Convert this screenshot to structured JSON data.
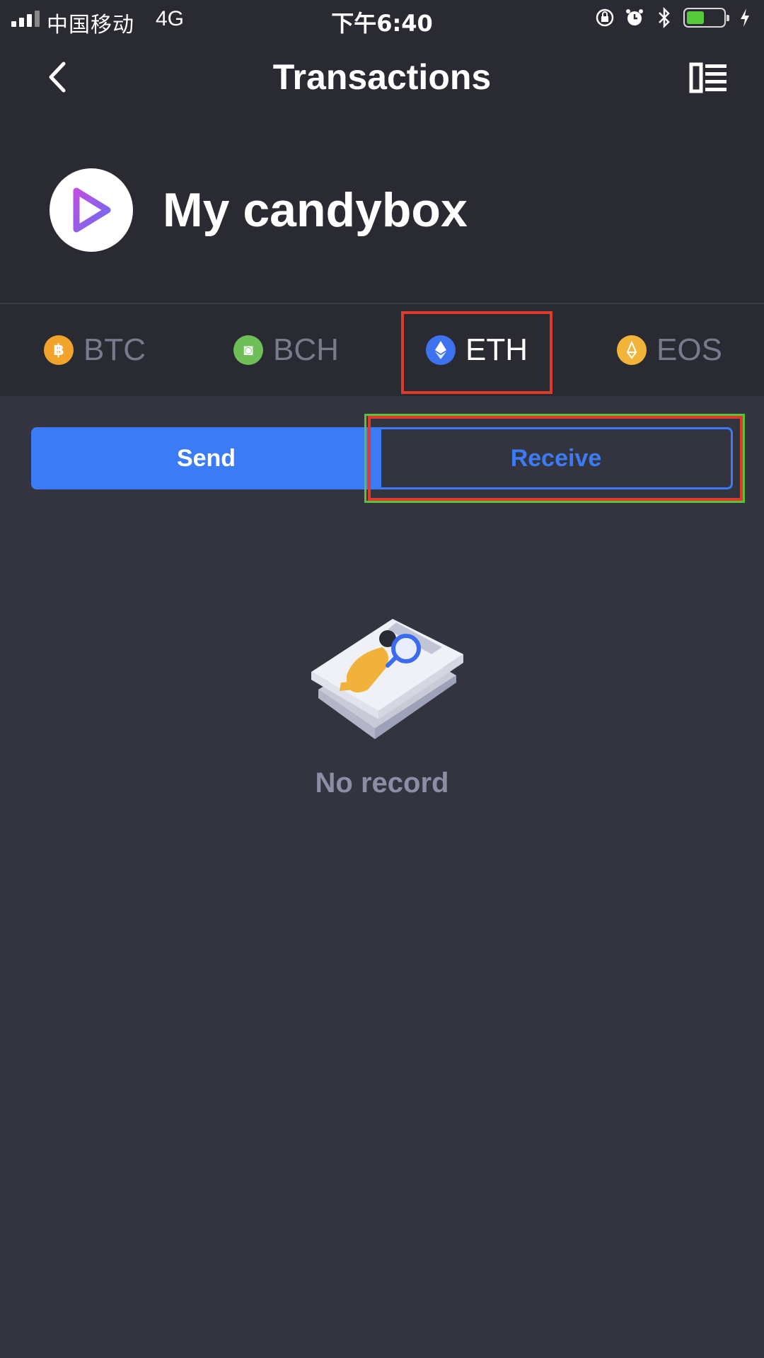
{
  "status_bar": {
    "carrier": "中国移动",
    "network": "4G",
    "time": "下午6:40",
    "battery_color": "#58c93a"
  },
  "nav": {
    "title": "Transactions",
    "back_icon": "chevron-left-icon",
    "menu_icon": "list-view-icon"
  },
  "wallet": {
    "name": "My candybox",
    "avatar_icon": "play-triangle-icon"
  },
  "tabs": [
    {
      "label": "BTC",
      "icon": "bitcoin-coin-icon",
      "color": "#f2a32b",
      "active": false
    },
    {
      "label": "BCH",
      "icon": "bitcoin-cash-coin-icon",
      "color": "#6fbf58",
      "active": false
    },
    {
      "label": "ETH",
      "icon": "ethereum-coin-icon",
      "color": "#3d72f0",
      "active": true
    },
    {
      "label": "EOS",
      "icon": "eos-coin-icon",
      "color": "#f2b53a",
      "active": false
    }
  ],
  "actions": {
    "send_label": "Send",
    "receive_label": "Receive",
    "accent": "#3b7cf6"
  },
  "empty_state": {
    "icon": "search-document-illustration",
    "text": "No record"
  }
}
